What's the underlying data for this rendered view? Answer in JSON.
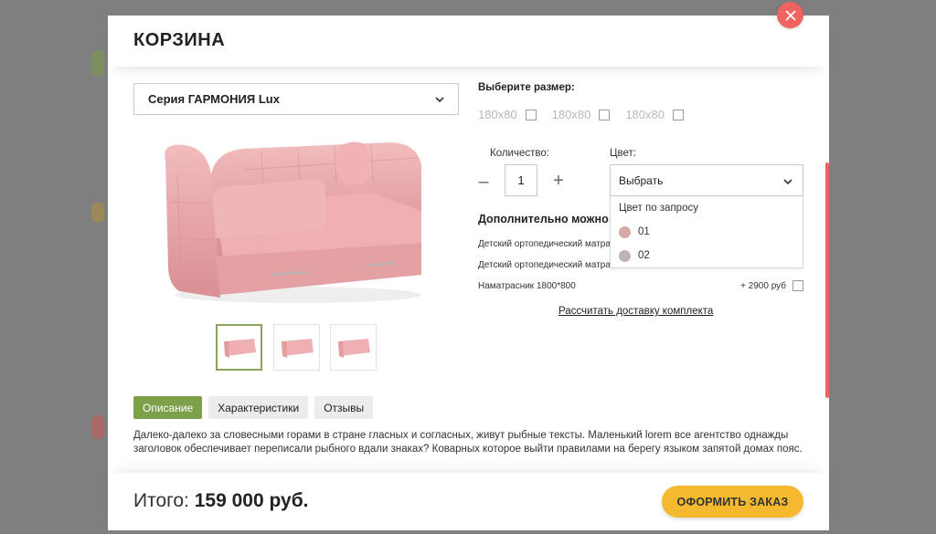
{
  "modal": {
    "title": "КОРЗИНА",
    "close_icon": "close-icon"
  },
  "product": {
    "series_select": "Серия ГАРМОНИЯ Lux",
    "thumbnails": [
      "sofa-thumb-1",
      "sofa-thumb-2",
      "sofa-thumb-3"
    ],
    "colors": {
      "sofa": "#e8a3a6",
      "accent": "#7ea04b"
    }
  },
  "size": {
    "title": "Выберите размер:",
    "options": [
      "180х80",
      "180х80",
      "180х80"
    ]
  },
  "quantity": {
    "label": "Количество:",
    "minus": "–",
    "value": "1",
    "plus": "+"
  },
  "color": {
    "label": "Цвет:",
    "selected": "Выбрать",
    "options": [
      {
        "label": "Цвет по запросу",
        "swatch": ""
      },
      {
        "label": "01",
        "swatch": "#d4a9a6"
      },
      {
        "label": "02",
        "swatch": "#c0b3b8"
      }
    ]
  },
  "extras": {
    "title": "Дополнительно можно",
    "items": [
      {
        "name": "Детский ортопедический матрас",
        "price": ""
      },
      {
        "name": "Детский ортопедический матрас",
        "price": ""
      },
      {
        "name": "Наматрасник 1800*800",
        "price": "+ 2900 руб"
      }
    ],
    "delivery_link": "Рассчитать доставку комплекта"
  },
  "tabs": [
    "Описание",
    "Характеристики",
    "Отзывы"
  ],
  "description": "Далеко-далеко за словесными горами в стране гласных и согласных, живут рыбные тексты. Маленький lorem все агентство однажды заголовок обеспечивает переписали рыбного вдали знаках? Коварных которое выйти правилами на берегу языком запятой домах пояс.",
  "footer": {
    "total_label": "Итого:",
    "total_value": "159 000 руб.",
    "order_button": "ОФОРМИТЬ ЗАКАЗ"
  }
}
